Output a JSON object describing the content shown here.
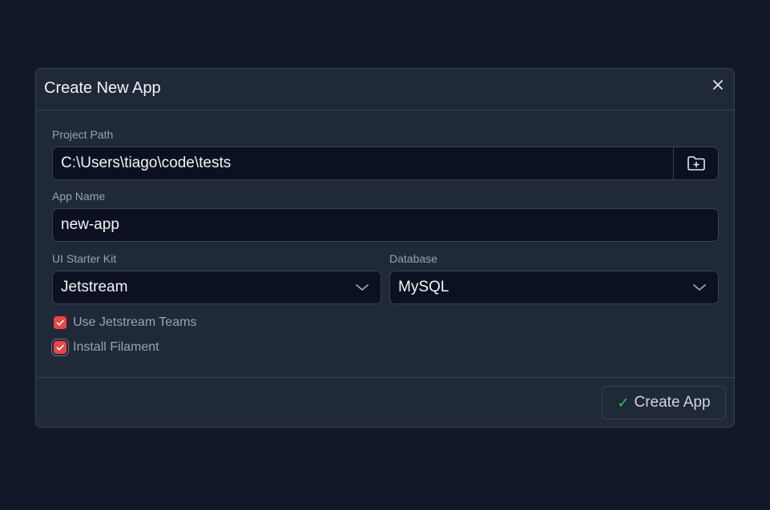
{
  "dialog": {
    "title": "Create New App",
    "close_icon": "close-icon"
  },
  "form": {
    "project_path": {
      "label": "Project Path",
      "value": "C:\\Users\\tiago\\code\\tests",
      "browse_icon": "folder-plus-icon"
    },
    "app_name": {
      "label": "App Name",
      "value": "new-app"
    },
    "starter_kit": {
      "label": "UI Starter Kit",
      "selected": "Jetstream"
    },
    "database": {
      "label": "Database",
      "selected": "MySQL"
    },
    "options": [
      {
        "label": "Use Jetstream Teams",
        "checked": true
      },
      {
        "label": "Install Filament",
        "checked": true
      }
    ]
  },
  "footer": {
    "create_label": "Create App",
    "create_icon": "check-icon"
  },
  "colors": {
    "background": "#111827",
    "panel": "#1f2937",
    "input": "#0b1120",
    "border": "#374151",
    "checkbox": "#ef4444",
    "success": "#22c55e"
  }
}
